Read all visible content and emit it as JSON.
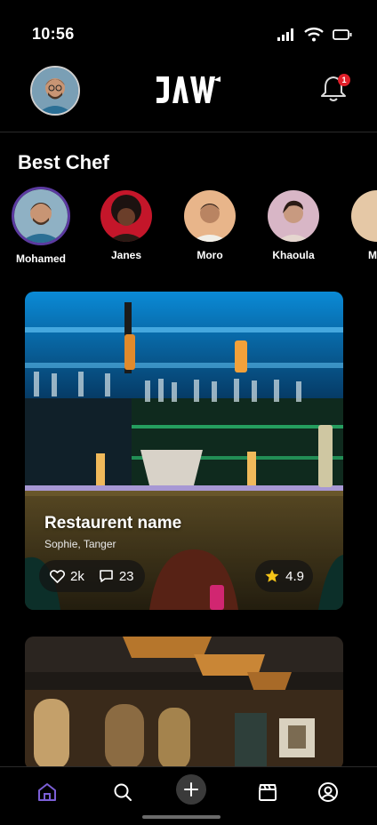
{
  "status_bar": {
    "time": "10:56"
  },
  "header": {
    "notification_count": "1"
  },
  "best_chef": {
    "title": "Best Chef",
    "chefs": [
      {
        "name": "Mohamed",
        "active": true
      },
      {
        "name": "Janes"
      },
      {
        "name": "Moro"
      },
      {
        "name": "Khaoula"
      },
      {
        "name": "Mia"
      }
    ]
  },
  "feed": {
    "cards": [
      {
        "title": "Restaurent name",
        "subtitle": "Sophie, Tanger",
        "likes": "2k",
        "comments": "23",
        "rating": "4.9"
      }
    ]
  },
  "colors": {
    "accent": "#6b4bc4",
    "badge": "#e0202a",
    "star": "#f5c518"
  },
  "icons": [
    "home-icon",
    "search-icon",
    "add-icon",
    "clapperboard-icon",
    "profile-icon",
    "bell-icon",
    "heart-icon",
    "comment-icon",
    "star-icon"
  ]
}
